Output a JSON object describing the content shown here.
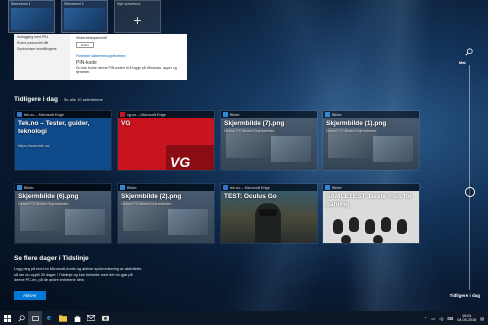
{
  "desktops": [
    {
      "label": "Skrivebord 1"
    },
    {
      "label": "Skrivebord 2"
    },
    {
      "label": "Nytt skrivebord"
    }
  ],
  "active_window": {
    "sidebar": [
      "Innlogging med PIN",
      "Endre passordet ditt",
      "Synkroniser innstillingene"
    ],
    "section": "Sikkerhetsspørsmål",
    "button": "Endre",
    "link": "Forbedre sikkerhetsopplevelsen",
    "pin_title": "PIN-kode",
    "pin_text": "Du kan bruke denne PIN-koden til å logge på Windows, apper og tjenester."
  },
  "header": {
    "title": "Tidligere i dag",
    "subtitle": "Se alle 10 aktivitetene"
  },
  "cards": [
    {
      "app": "tek.no – Microsoft Edge",
      "title": "Tek.no – Tester, guider, teknologi",
      "subtitle": "https://www.tek.no/"
    },
    {
      "app": "vg.no – Microsoft Edge",
      "title": "VG",
      "subtitle": ""
    },
    {
      "app": "Bilder",
      "title": "Skjermbilde (7).png",
      "subtitle": "Denne PC\\Bilder\\Skjermbilder"
    },
    {
      "app": "Bilder",
      "title": "Skjermbilde (1).png",
      "subtitle": "Denne PC\\Bilder\\Skjermbilder"
    },
    {
      "app": "Bilder",
      "title": "Skjermbilde (6).png",
      "subtitle": "Denne PC\\Bilder\\Skjermbilder"
    },
    {
      "app": "Bilder",
      "title": "Skjermbilde (2).png",
      "subtitle": "Denne PC\\Bilder\\Skjermbilder"
    },
    {
      "app": "tek.no – Microsoft Edge",
      "title": "TEST: Oculus Go",
      "subtitle": "https://www.tek.no/"
    },
    {
      "app": "Bilder",
      "title": "SAMLETEST: Beste mus for gaming",
      "subtitle": "https://www.tek.no/"
    }
  ],
  "promo": {
    "title": "Se flere dager i Tidslinje",
    "text": "Logg deg på med en Microsoft-konto og aktiver synkronisering av aktiviteter, så ser du opptil 30 dager i Tidslinje og kan fortsette med det du gjør på denne PC-en, på de andre enhetene dine.",
    "button": "Aktiver"
  },
  "timeline": {
    "top_label": "Mai",
    "label": "Tidligere i dag"
  },
  "taskbar": {
    "time": "19:01",
    "date": "04.05.2018"
  }
}
